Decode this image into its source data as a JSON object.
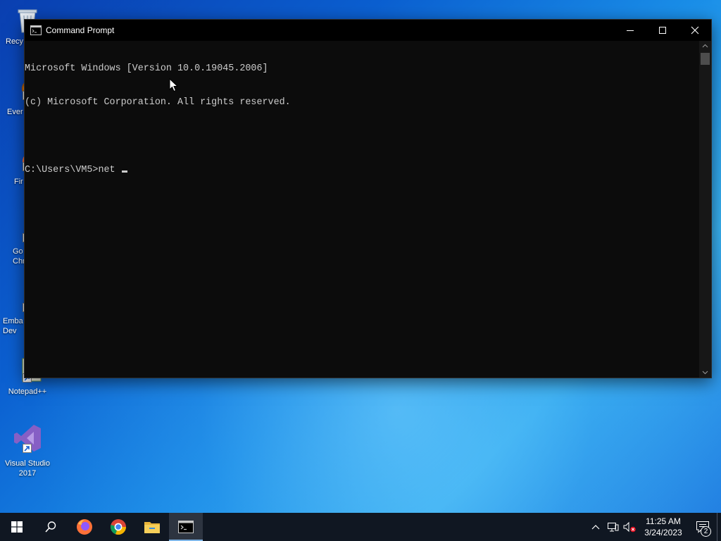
{
  "desktop": {
    "icons": [
      {
        "label": "Recy",
        "icon": "recycle-bin-icon"
      },
      {
        "label": "Ever",
        "icon": "everything-icon"
      },
      {
        "label": "Fir",
        "icon": "firefox-icon"
      },
      {
        "label": "Go\nChr",
        "icon": "chrome-icon"
      },
      {
        "label": "Emba\nDev",
        "icon": "embarcadero-icon"
      },
      {
        "label": "Notepad++",
        "icon": "notepad-plus-plus-icon"
      },
      {
        "label": "Visual Studio\n2017",
        "icon": "visual-studio-icon"
      }
    ]
  },
  "window": {
    "title": "Command Prompt",
    "icon": "cmd-icon",
    "buttons": {
      "minimize": "minimize-icon",
      "maximize": "maximize-icon",
      "close": "close-icon"
    },
    "console_lines": [
      "Microsoft Windows [Version 10.0.19045.2006]",
      "(c) Microsoft Corporation. All rights reserved.",
      "",
      "C:\\Users\\VM5>net "
    ]
  },
  "taskbar": {
    "items": [
      {
        "name": "start",
        "icon": "windows-start-icon"
      },
      {
        "name": "search",
        "icon": "search-icon"
      },
      {
        "name": "firefox",
        "icon": "firefox-icon"
      },
      {
        "name": "chrome",
        "icon": "chrome-icon"
      },
      {
        "name": "file-explorer",
        "icon": "folder-icon"
      },
      {
        "name": "command-prompt",
        "icon": "cmd-icon",
        "active": true
      }
    ],
    "tray": {
      "time": "11:25 AM",
      "date": "3/24/2023",
      "notification_count": "2"
    }
  },
  "colors": {
    "console_bg": "#0c0c0c",
    "console_text": "#cccccc",
    "taskbar_bg": "#101722",
    "accent": "#0b5fd0"
  }
}
